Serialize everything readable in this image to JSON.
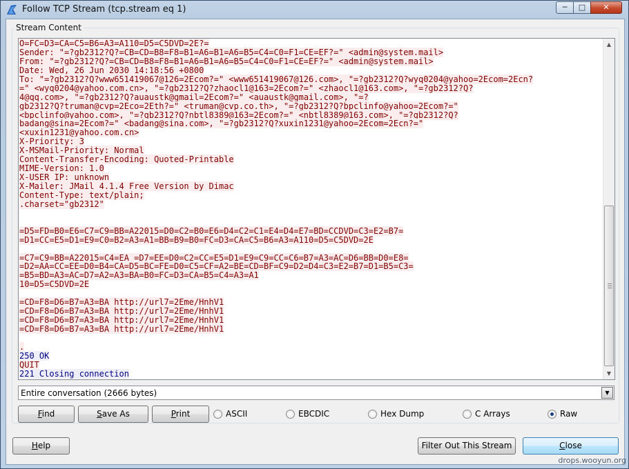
{
  "window": {
    "title": "Follow TCP Stream (tcp.stream eq 1)",
    "min_label": "─",
    "max_label": "□",
    "close_label": "✕"
  },
  "stream_group": {
    "label": "Stream Content"
  },
  "stream_lines": [
    {
      "t": "O=FC=D3=CA=C5=B6=A3=A110=D5=C5DVD=2E?=",
      "k": "c"
    },
    {
      "t": "Sender: \"=?gb2312?Q?=CB=CD=B8=F8=B1=A6=B1=A6=B5=C4=C0=F1=CE=EF?=\" <admin@system.mail>",
      "k": "c"
    },
    {
      "t": "From: \"=?gb2312?Q?=CB=CD=B8=F8=B1=A6=B1=A6=B5=C4=C0=F1=CE=EF?=\" <admin@system.mail>",
      "k": "c"
    },
    {
      "t": "Date: Wed, 26 Jun 2030 14:18:56 +0800",
      "k": "c"
    },
    {
      "t": "To: \"=?gb2312?Q?www651419067@126=2Ecom?=\" <www651419067@126.com>, \"=?gb2312?Q?wyq0204@yahoo=2Ecom=2Ecn?",
      "k": "c"
    },
    {
      "t": "=\" <wyq0204@yahoo.com.cn>, \"=?gb2312?Q?zhaocl1@163=2Ecom?=\" <zhaocl1@163.com>, \"=?gb2312?Q?",
      "k": "c"
    },
    {
      "t": "@qq.com>, \"=?gb2312?Q?auaustk@gmail=2Ecom?=\" <auaustk@gmail.com>, \"=?",
      "k": "c",
      "prefix": "4",
      "redacted": true
    },
    {
      "t": "gb2312?Q?truman@cvp=2Eco=2Eth?=\" <truman@cvp.co.th>, \"=?gb2312?Q?bpclinfo@yahoo=2Ecom?=\"",
      "k": "c"
    },
    {
      "t": "<bpclinfo@yahoo.com>, \"=?gb2312?Q?nbtl8389@163=2Ecom?=\" <nbtl8389@163.com>, \"=?gb2312?Q?",
      "k": "c"
    },
    {
      "t": "badang@sina=2Ecom?=\" <badang@sina.com>, \"=?gb2312?Q?xuxin1231@yahoo=2Ecom=2Ecn?=\"",
      "k": "c"
    },
    {
      "t": "<xuxin1231@yahoo.com.cn>",
      "k": "c"
    },
    {
      "t": "X-Priority: 3",
      "k": "c"
    },
    {
      "t": "X-MSMail-Priority: Normal",
      "k": "c"
    },
    {
      "t": "Content-Transfer-Encoding: Quoted-Printable",
      "k": "c"
    },
    {
      "t": "MIME-Version: 1.0",
      "k": "c"
    },
    {
      "t": "X-USER_IP: unknown",
      "k": "c"
    },
    {
      "t": "X-Mailer: JMail 4.1.4 Free Version by Dimac",
      "k": "c"
    },
    {
      "t": "Content-Type: text/plain;",
      "k": "c"
    },
    {
      "t": ".charset=\"gb2312\"",
      "k": "c"
    },
    {
      "t": "",
      "k": "c"
    },
    {
      "t": "",
      "k": ""
    },
    {
      "t": "=D5=FD=B0=E6=C7=C9=BB=A22015=D0=C2=B0=E6=D4=C2=C1=E4=D4=E7=BD=CCDVD=C3=E2=B7=",
      "k": "c"
    },
    {
      "t": "=D1=CC=E5=D1=E9=C0=B2=A3=A1=BB=B9=B0=FC=D3=CA=C5=B6=A3=A110=D5=C5DVD=2E",
      "k": "c"
    },
    {
      "t": "",
      "k": ""
    },
    {
      "t": "=C7=C9=BB=A22015=C4=EA =D7=EE=D0=C2=CC=E5=D1=E9=C9=CC=C6=B7=A3=AC=D6=BB=D0=E8=",
      "k": "c"
    },
    {
      "t": "=D2=AA=CC=EE=D0=B4=CA=D5=BC=FE=D0=C5=CF=A2=BE=CD=BF=C9=D2=D4=C3=E2=B7=D1=B5=C3=",
      "k": "c"
    },
    {
      "t": "=B5=BD=A3=AC=D7=A2=A3=BA=B0=FC=D3=CA=B5=C4=A3=A1",
      "k": "c"
    },
    {
      "t": "10=D5=C5DVD=2E",
      "k": "c"
    },
    {
      "t": "",
      "k": ""
    },
    {
      "t": "=CD=F8=D6=B7=A3=BA http://url7=2Eme/HnhV1",
      "k": "c"
    },
    {
      "t": "=CD=F8=D6=B7=A3=BA http://url7=2Eme/HnhV1",
      "k": "c"
    },
    {
      "t": "=CD=F8=D6=B7=A3=BA http://url7=2Eme/HnhV1",
      "k": "c"
    },
    {
      "t": "=CD=F8=D6=B7=A3=BA http://url7=2Eme/HnhV1",
      "k": "c"
    },
    {
      "t": "",
      "k": ""
    },
    {
      "t": ".",
      "k": "c"
    },
    {
      "t": "250 OK",
      "k": "s"
    },
    {
      "t": "QUIT",
      "k": "c"
    },
    {
      "t": "221 Closing connection",
      "k": "s"
    }
  ],
  "conversation_select": {
    "value": "Entire conversation (2666 bytes)",
    "arrow": "▼"
  },
  "buttons": {
    "find": "Find",
    "save_as": "Save As",
    "print": "Print",
    "help": "Help",
    "filter_out": "Filter Out This Stream",
    "close": "Close"
  },
  "radios": {
    "ascii": "ASCII",
    "ebcdic": "EBCDIC",
    "hex_dump": "Hex Dump",
    "c_arrays": "C Arrays",
    "raw": "Raw",
    "selected": "raw"
  },
  "scroll": {
    "up": "▲",
    "down": "▼"
  },
  "watermark": "drops.wooyun.org",
  "colors": {
    "client_text": "#7f0000",
    "client_bg": "#fbeded",
    "server_text": "#00007f",
    "server_bg": "#eeeef9",
    "redaction": "#e8000b"
  }
}
